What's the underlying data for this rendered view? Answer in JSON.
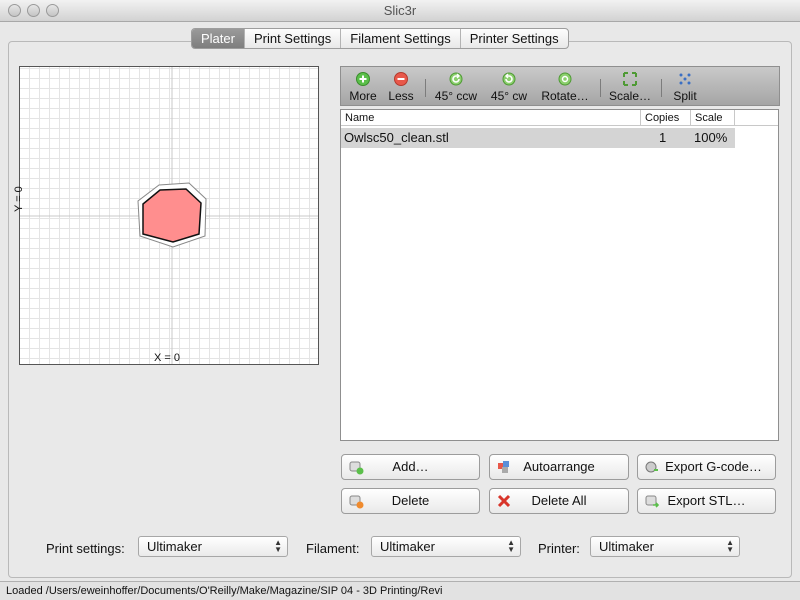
{
  "window": {
    "title": "Slic3r"
  },
  "tabs": [
    "Plater",
    "Print Settings",
    "Filament Settings",
    "Printer Settings"
  ],
  "plater": {
    "x_label": "X = 0",
    "y_label": "Y = 0"
  },
  "toolbar": [
    {
      "icon": "plus-circle-icon",
      "label": "More"
    },
    {
      "icon": "minus-circle-icon",
      "label": "Less"
    },
    {
      "icon": "rotate-ccw-icon",
      "label": "45° ccw"
    },
    {
      "icon": "rotate-cw-icon",
      "label": "45° cw"
    },
    {
      "icon": "rotate-icon",
      "label": "Rotate…"
    },
    {
      "icon": "scale-icon",
      "label": "Scale…"
    },
    {
      "icon": "split-icon",
      "label": "Split"
    }
  ],
  "object_list": {
    "columns": [
      "Name",
      "Copies",
      "Scale"
    ],
    "rows": [
      {
        "name": "Owlsc50_clean.stl",
        "copies": "1",
        "scale": "100%"
      }
    ]
  },
  "buttons": {
    "add": "Add…",
    "autoarrange": "Autoarrange",
    "export_gcode": "Export G-code…",
    "delete": "Delete",
    "delete_all": "Delete All",
    "export_stl": "Export STL…"
  },
  "settings": {
    "print_label": "Print settings:",
    "print_value": "Ultimaker",
    "filament_label": "Filament:",
    "filament_value": "Ultimaker",
    "printer_label": "Printer:",
    "printer_value": "Ultimaker"
  },
  "status": "Loaded  /Users/eweinhoffer/Documents/O'Reilly/Make/Magazine/SIP 04 - 3D Printing/Revi",
  "colors": {
    "object_fill": "#ff8e8e",
    "active_tab": "#8a8a8a",
    "selected_row": "#d4d4d4"
  }
}
